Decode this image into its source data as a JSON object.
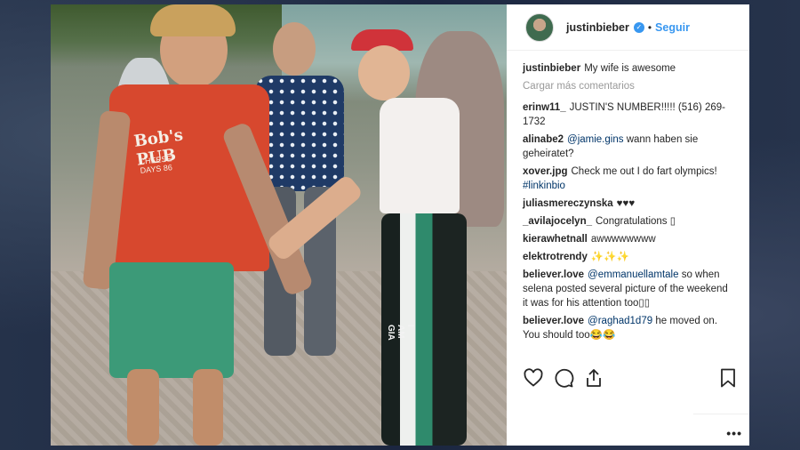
{
  "post": {
    "username": "justinbieber",
    "follow_label": "Seguir",
    "dot": "•",
    "caption_user": "justinbieber",
    "caption_text": "My wife is awesome",
    "load_more": "Cargar más comentarios",
    "shirt_text": "Bob's PUB",
    "shirt_subtext": "CHEESE DAYS 86",
    "pants_text": "I AM GIA"
  },
  "comments": [
    {
      "user": "erinw11_",
      "mention": "",
      "text": "JUSTIN'S NUMBER!!!!! (516) 269-1732"
    },
    {
      "user": "alinabe2",
      "mention": "@jamie.gins",
      "text": "wann haben sie geheiratet?"
    },
    {
      "user": "xover.jpg",
      "mention": "",
      "text": "Check me out I do fart olympics!",
      "tag": "#linkinbio"
    },
    {
      "user": "juliasmereczynska",
      "mention": "",
      "text": "♥♥♥"
    },
    {
      "user": "_avilajocelyn_",
      "mention": "",
      "text": "Congratulations ▯"
    },
    {
      "user": "kierawhetnall",
      "mention": "",
      "text": "awwwwwwww"
    },
    {
      "user": "elektrotrendy",
      "mention": "",
      "text": "✨✨✨"
    },
    {
      "user": "believer.love",
      "mention": "@emmanuellamtale",
      "text": "so when selena posted several picture of the weekend it was for his attention too▯▯"
    },
    {
      "user": "believer.love",
      "mention": "@raghad1d79",
      "text": "he moved on. You should too😂😂"
    }
  ],
  "icons": {
    "verified": "verified-badge-icon",
    "like": "heart-icon",
    "comment": "comment-icon",
    "share": "share-icon",
    "save": "bookmark-icon",
    "more": "more-options-icon"
  },
  "more_label": "•••",
  "colors": {
    "link": "#3897f0",
    "mention": "#003569",
    "muted": "#999999",
    "text": "#262626"
  }
}
